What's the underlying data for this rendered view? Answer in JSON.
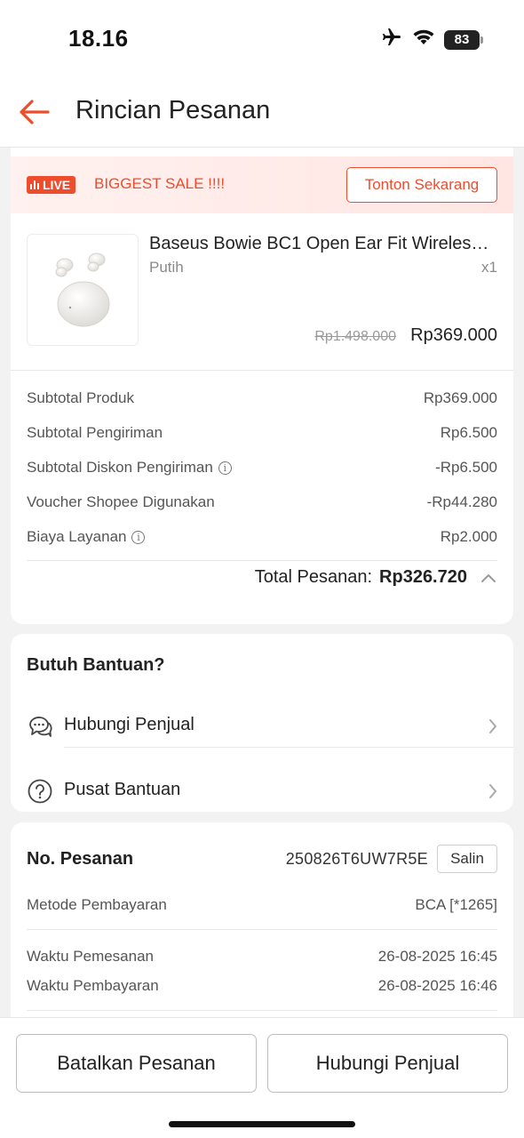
{
  "status_bar": {
    "time": "18.16",
    "battery": "83"
  },
  "header": {
    "title": "Rincian Pesanan"
  },
  "live_banner": {
    "badge": "LIVE",
    "text": "BIGGEST SALE !!!!",
    "button": "Tonton Sekarang"
  },
  "product": {
    "name": "Baseus Bowie BC1 Open Ear Fit Wireless Earbuds",
    "variant": "Putih",
    "qty": "x1",
    "price_old": "Rp1.498.000",
    "price_new": "Rp369.000"
  },
  "summary": {
    "rows": [
      {
        "label": "Subtotal Produk",
        "value": "Rp369.000",
        "info": false
      },
      {
        "label": "Subtotal Pengiriman",
        "value": "Rp6.500",
        "info": false
      },
      {
        "label": "Subtotal Diskon Pengiriman",
        "value": "-Rp6.500",
        "info": true
      },
      {
        "label": "Voucher Shopee Digunakan",
        "value": "-Rp44.280",
        "info": false
      },
      {
        "label": "Biaya Layanan",
        "value": "Rp2.000",
        "info": true
      }
    ],
    "total_label": "Total Pesanan:",
    "total_value": "Rp326.720"
  },
  "help": {
    "title": "Butuh Bantuan?",
    "items": [
      {
        "label": "Hubungi Penjual",
        "icon": "chat-icon"
      },
      {
        "label": "Pusat Bantuan",
        "icon": "question-icon"
      }
    ]
  },
  "order": {
    "label": "No. Pesanan",
    "number": "250826T6UW7R5E",
    "copy": "Salin",
    "payment_method_label": "Metode Pembayaran",
    "payment_method": "BCA [*1265]",
    "order_time_label": "Waktu Pemesanan",
    "order_time": "26-08-2025 16:45",
    "payment_time_label": "Waktu Pembayaran",
    "payment_time": "26-08-2025 16:46"
  },
  "actions": {
    "cancel": "Batalkan Pesanan",
    "contact": "Hubungi Penjual"
  },
  "colors": {
    "accent": "#ee4d2d",
    "background": "#f2f2f2"
  }
}
